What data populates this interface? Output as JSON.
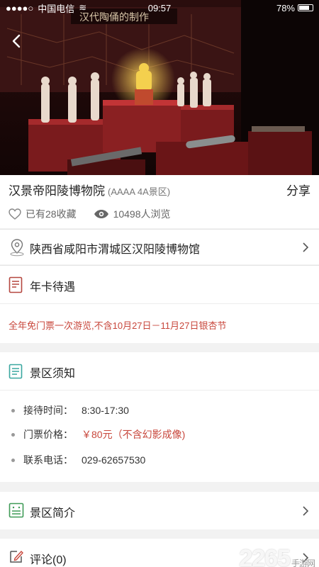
{
  "status_bar": {
    "carrier": "中国电信",
    "time": "09:57",
    "battery": "78%",
    "battery_level": 0.78
  },
  "hero": {
    "banner_text": "汉代陶俑的制作"
  },
  "scenic": {
    "name": "汉景帝阳陵博物院",
    "level": "(AAAA 4A景区)",
    "share_label": "分享",
    "favorites": "已有28收藏",
    "views": "10498人浏览"
  },
  "address": {
    "label": "陕西省咸阳市渭城区汉阳陵博物馆"
  },
  "annual_card": {
    "title": "年卡待遇",
    "benefit": "全年免门票一次游览,不含10月27日－11月27日银杏节"
  },
  "notice": {
    "title": "景区须知",
    "items": [
      {
        "key": "接待时间：",
        "value": "8:30-17:30"
      },
      {
        "key": "门票价格：",
        "value": "￥80元（不含幻影成像)"
      },
      {
        "key": "联系电话：",
        "value": "029-62657530"
      }
    ]
  },
  "intro": {
    "title": "景区简介"
  },
  "comments": {
    "title": "评论(0)"
  },
  "watermark": {
    "brand": "2265",
    "sub": "手游网"
  },
  "colors": {
    "accent_red": "#c8473c",
    "icon_red": "#b5473f",
    "icon_teal": "#3aa7a0",
    "icon_green": "#3f9b57"
  }
}
